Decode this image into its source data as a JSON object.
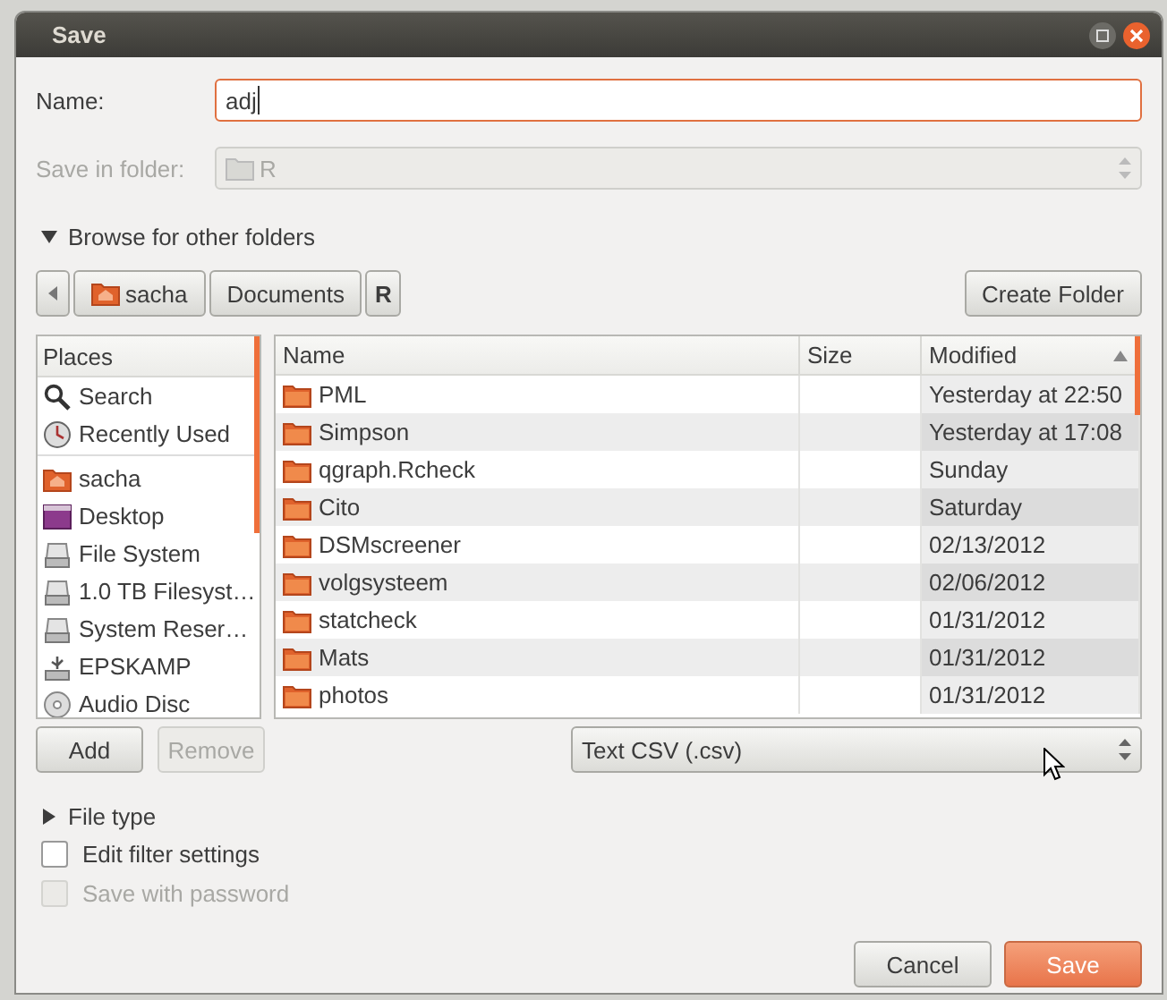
{
  "window": {
    "title": "Save"
  },
  "name_field": {
    "label": "Name:",
    "value": "adj"
  },
  "save_in_folder": {
    "label": "Save in folder:",
    "value": "R",
    "disabled": true
  },
  "browse_expander": {
    "label": "Browse for other folders",
    "expanded": true
  },
  "path_bar": [
    {
      "label": "sacha",
      "kind": "home",
      "selected": false
    },
    {
      "label": "Documents",
      "kind": "folder",
      "selected": false
    },
    {
      "label": "R",
      "kind": "folder",
      "selected": true
    }
  ],
  "create_folder_button": "Create Folder",
  "places": {
    "header": "Places",
    "groups": [
      [
        {
          "label": "Search",
          "kind": "search"
        },
        {
          "label": "Recently Used",
          "kind": "recent"
        }
      ],
      [
        {
          "label": "sacha",
          "kind": "home"
        },
        {
          "label": "Desktop",
          "kind": "desktop"
        },
        {
          "label": "File System",
          "kind": "drive"
        },
        {
          "label": "1.0 TB Filesyst…",
          "kind": "drive"
        },
        {
          "label": "System Reser…",
          "kind": "drive"
        },
        {
          "label": "EPSKAMP",
          "kind": "usb"
        },
        {
          "label": "Audio Disc",
          "kind": "disc"
        }
      ]
    ]
  },
  "files": {
    "columns": [
      {
        "label": "Name",
        "sorted": false
      },
      {
        "label": "Size",
        "sorted": false
      },
      {
        "label": "Modified",
        "sorted": true
      }
    ],
    "rows": [
      {
        "name": "PML",
        "modified": "Yesterday at 22:50"
      },
      {
        "name": "Simpson",
        "modified": "Yesterday at 17:08"
      },
      {
        "name": "qgraph.Rcheck",
        "modified": "Sunday"
      },
      {
        "name": "Cito",
        "modified": "Saturday"
      },
      {
        "name": "DSMscreener",
        "modified": "02/13/2012"
      },
      {
        "name": "volgsysteem",
        "modified": "02/06/2012"
      },
      {
        "name": "statcheck",
        "modified": "01/31/2012"
      },
      {
        "name": "Mats",
        "modified": "01/31/2012"
      },
      {
        "name": "photos",
        "modified": "01/31/2012"
      }
    ]
  },
  "add_button": {
    "label": "Add",
    "disabled": false
  },
  "remove_button": {
    "label": "Remove",
    "disabled": true
  },
  "filter": {
    "value": "Text CSV (.csv)"
  },
  "file_type_expander": {
    "label": "File type",
    "expanded": false
  },
  "checkboxes": [
    {
      "label": "Edit filter settings",
      "checked": false,
      "disabled": false
    },
    {
      "label": "Save with password",
      "checked": false,
      "disabled": true
    }
  ],
  "buttons": [
    {
      "label": "Cancel",
      "kind": "secondary"
    },
    {
      "label": "Save",
      "kind": "primary"
    }
  ]
}
